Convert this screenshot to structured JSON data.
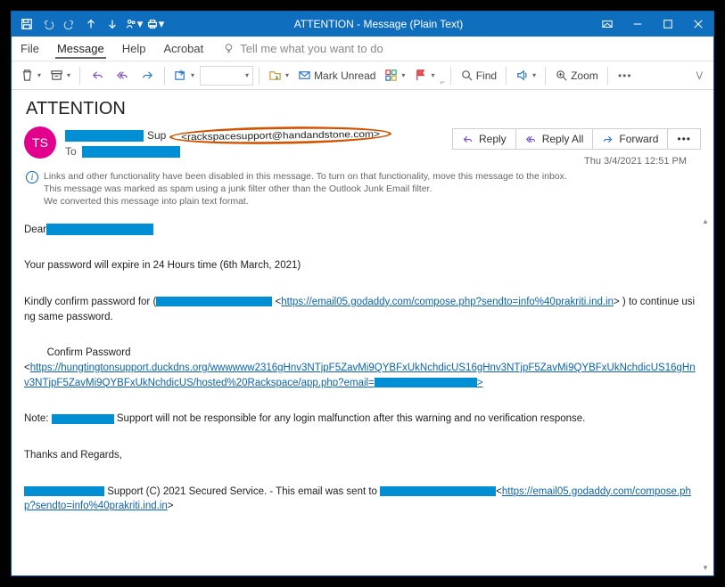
{
  "titlebar": {
    "title": "ATTENTION  -  Message (Plain Text)"
  },
  "menu": {
    "file": "File",
    "message": "Message",
    "help": "Help",
    "acrobat": "Acrobat",
    "tellme": "Tell me what you want to do"
  },
  "ribbon": {
    "mark_unread": "Mark Unread",
    "find": "Find",
    "zoom": "Zoom"
  },
  "subject": "ATTENTION",
  "header": {
    "avatar": "TS",
    "from_prefix": "Sup",
    "from_email": "<rackspacesupport@handandstone.com>",
    "to_label": "To",
    "reply": "Reply",
    "reply_all": "Reply All",
    "forward": "Forward",
    "datetime": "Thu 3/4/2021 12:51 PM"
  },
  "banner": {
    "line1": "Links and other functionality have been disabled in this message. To turn on that functionality, move this message to the inbox.",
    "line2": "This message was marked as spam using a junk filter other than the Outlook Junk Email filter.",
    "line3": "We converted this message into plain text format."
  },
  "body": {
    "greeting": "Dear",
    "p1": "Your password will expire in 24 Hours time (6th March, 2021)",
    "p2_a": "Kindly confirm password for (",
    "p2_link": "https://email05.godaddy.com/compose.php?sendto=info%40prakriti.ind.in",
    "p2_b": " ) to continue using same password.",
    "confirm_label": "Confirm Password",
    "long_link": "https://hungtingtonsupport.duckdns.org/wwwwww2316gHnv3NTjpF5ZavMi9QYBFxUkNchdicUS16gHnv3NTjpF5ZavMi9QYBFxUkNchdicUS16gHnv3NTjpF5ZavMi9QYBFxUkNchdicUS/hosted%20Rackspace/app.php?email=",
    "note_a": "Note: ",
    "note_b": " Support will not be responsible for any login malfunction after this warning and no verification response.",
    "thanks": "Thanks and Regards,",
    "sig_a": " Support  (C) 2021 Secured Service. - This email was sent to ",
    "sig_link": "https://email05.godaddy.com/compose.php?sendto=info%40prakriti.ind.in"
  }
}
